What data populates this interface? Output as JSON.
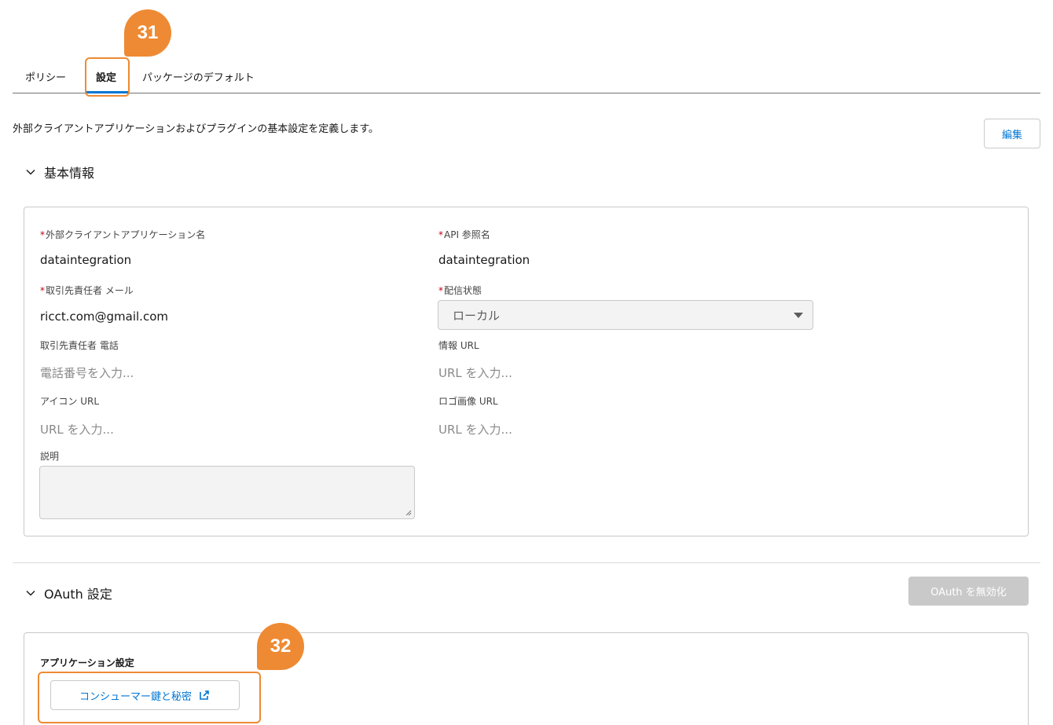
{
  "tabs": [
    {
      "label": "ポリシー"
    },
    {
      "label": "設定"
    },
    {
      "label": "パッケージのデフォルト"
    }
  ],
  "callouts": {
    "first": "31",
    "second": "32"
  },
  "description": "外部クライアントアプリケーションおよびプラグインの基本設定を定義します。",
  "edit_button": "編集",
  "basic_info": {
    "title": "基本情報",
    "fields": {
      "app_name": {
        "label": "外部クライアントアプリケーション名",
        "required": "*",
        "value": "dataintegration"
      },
      "api_name": {
        "label": "API 参照名",
        "required": "*",
        "value": "dataintegration"
      },
      "contact_email": {
        "label": "取引先責任者 メール",
        "required": "*",
        "value": "ricct.com@gmail.com"
      },
      "distribution_state": {
        "label": "配信状態",
        "required": "*",
        "value": "ローカル"
      },
      "contact_phone": {
        "label": "取引先責任者 電話",
        "placeholder": "電話番号を入力..."
      },
      "info_url": {
        "label": "情報 URL",
        "placeholder": "URL を入力..."
      },
      "icon_url": {
        "label": "アイコン URL",
        "placeholder": "URL を入力..."
      },
      "logo_url": {
        "label": "ロゴ画像 URL",
        "placeholder": "URL を入力..."
      },
      "description": {
        "label": "説明"
      }
    }
  },
  "oauth": {
    "title": "OAuth 設定",
    "disable_button": "OAuth を無効化",
    "app_settings_label": "アプリケーション設定",
    "consumer_button": "コンシューマー鍵と秘密"
  },
  "colors": {
    "accent": "#0176d3",
    "callout": "#ee8a33",
    "required": "#ba0517"
  }
}
